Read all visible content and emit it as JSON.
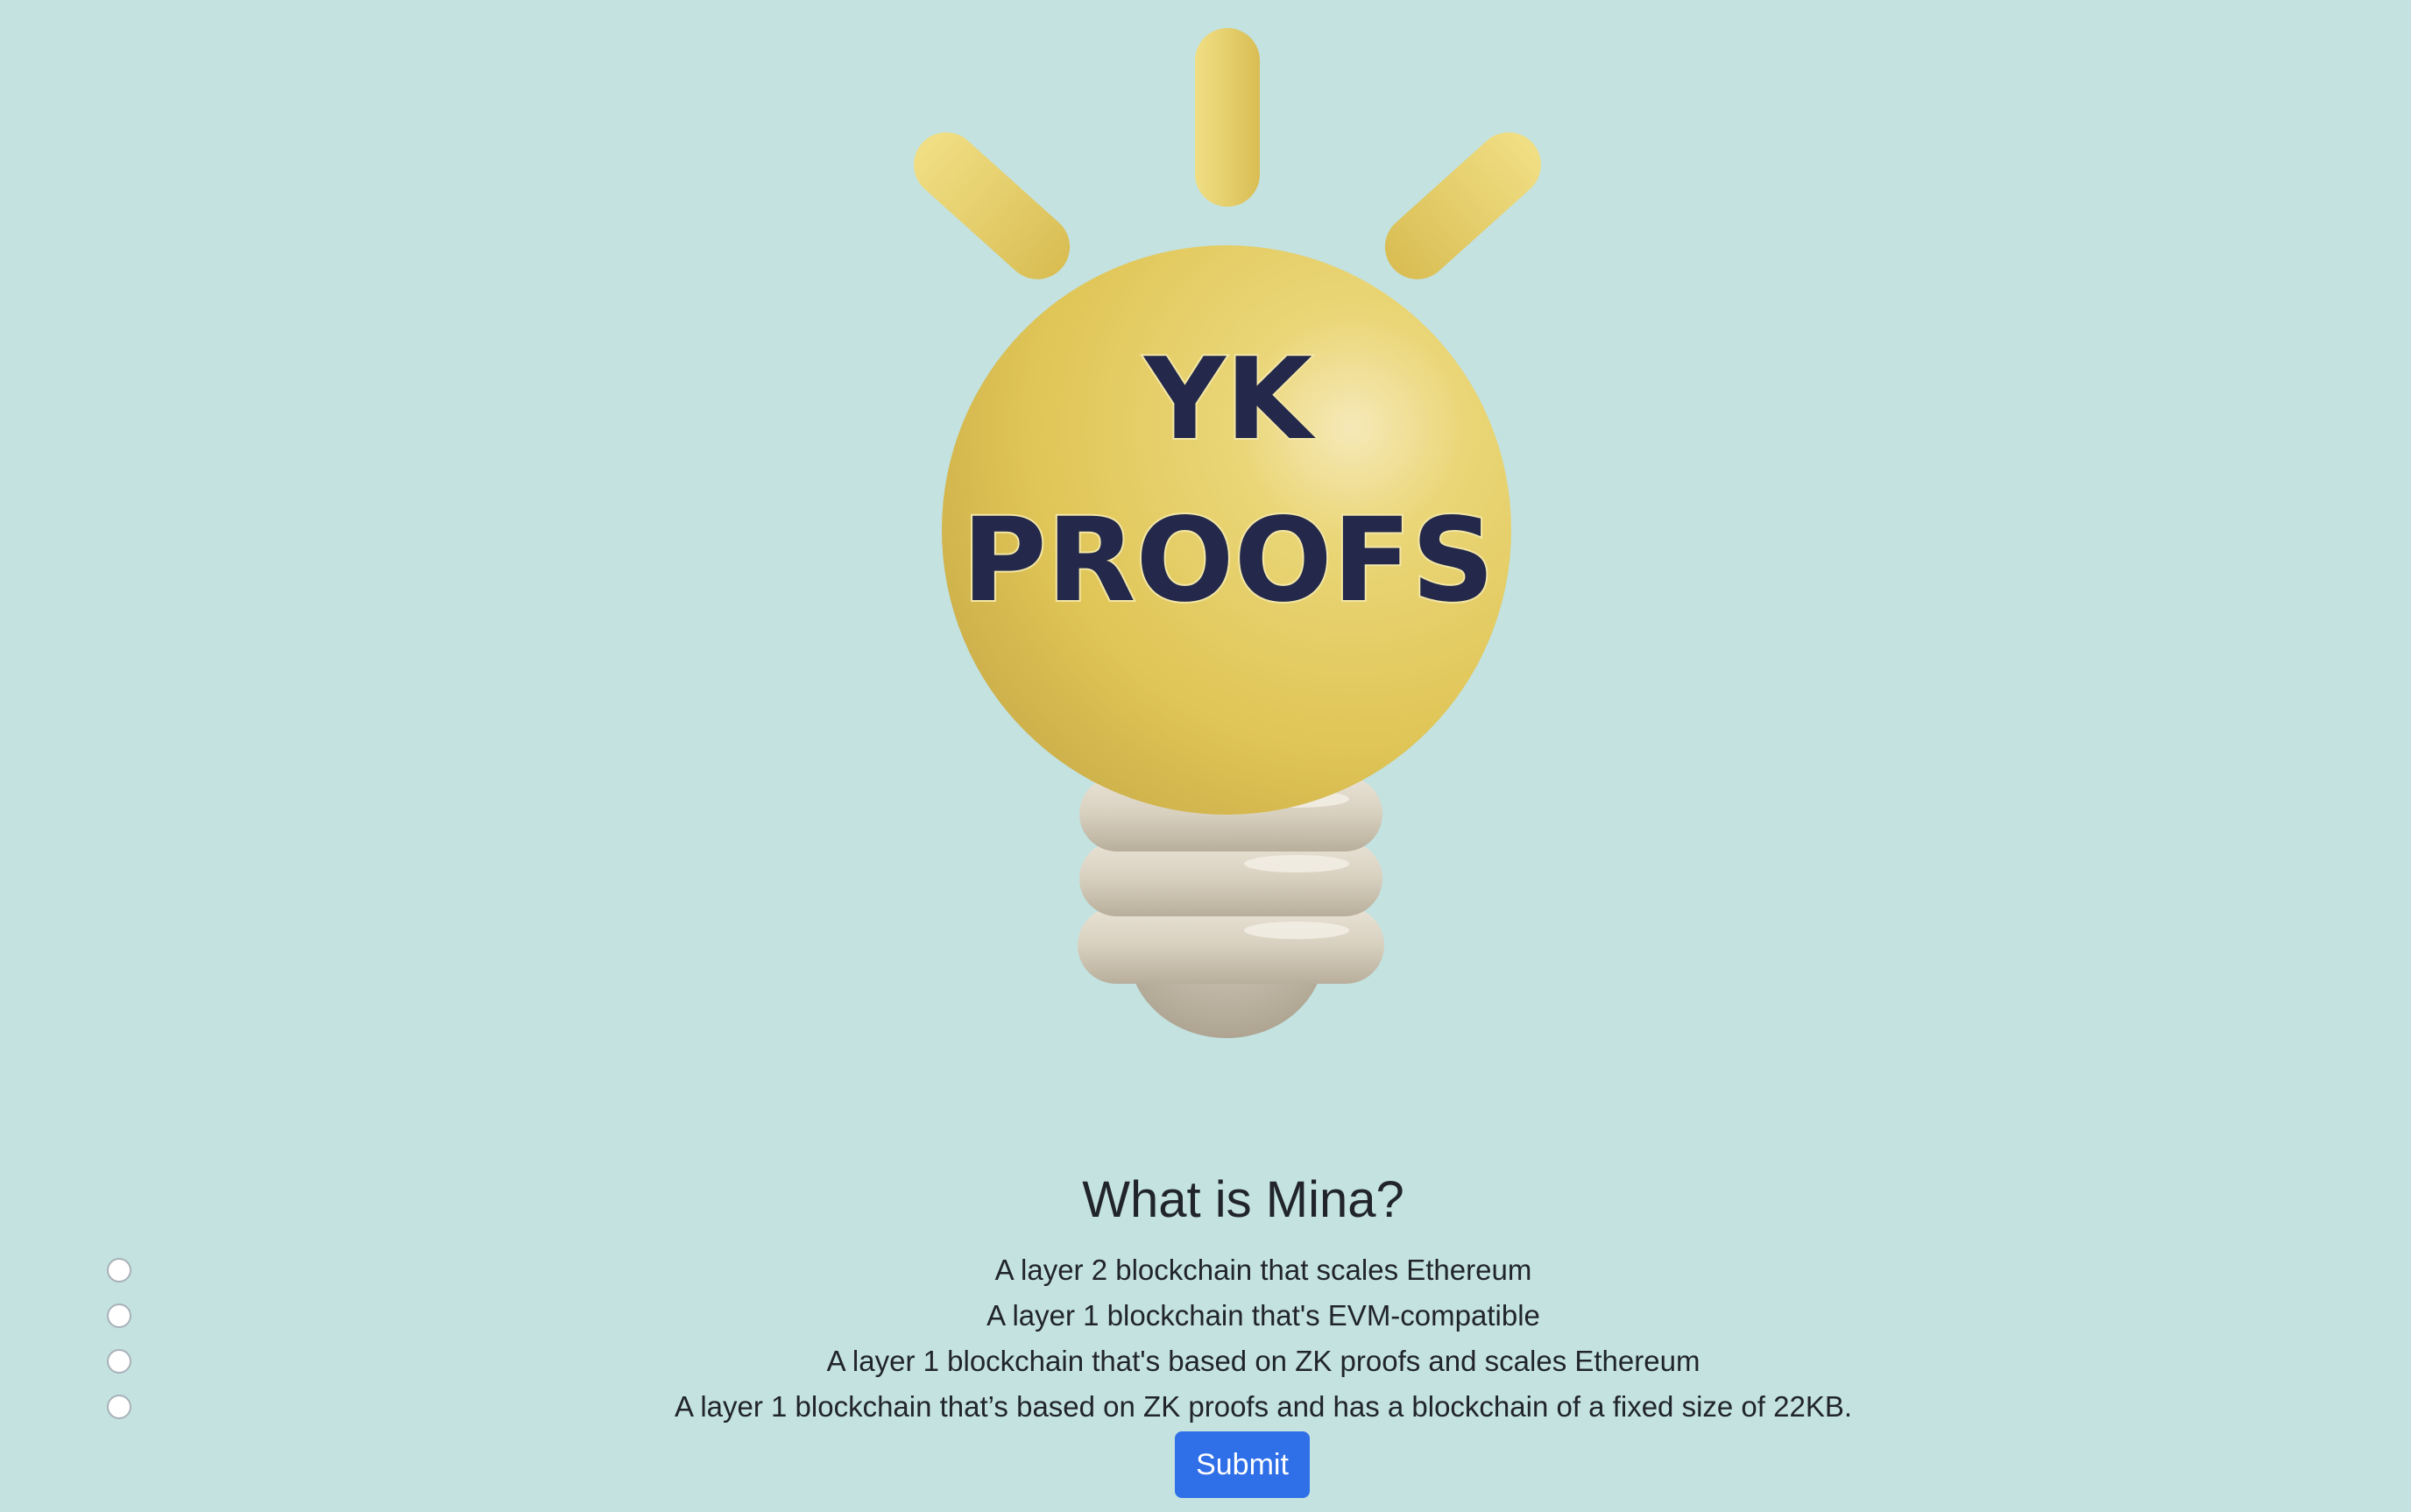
{
  "logo": {
    "line1": "YK",
    "line2": "PROOFS"
  },
  "quiz": {
    "question": "What is Mina?",
    "options": [
      {
        "label": "A layer 2 blockchain that scales Ethereum",
        "selected": false
      },
      {
        "label": "A layer 1 blockchain that's EVM-compatible",
        "selected": false
      },
      {
        "label": "A layer 1 blockchain that's based on ZK proofs and scales Ethereum",
        "selected": false
      },
      {
        "label": "A layer 1 blockchain that’s based on ZK proofs and has a blockchain of a fixed size of 22KB.",
        "selected": false
      }
    ],
    "submit_label": "Submit"
  },
  "colors": {
    "background": "#c3e2e0",
    "bulb": "#e6ce5f",
    "logo_text": "#24284a",
    "button": "#2f6fe8"
  }
}
